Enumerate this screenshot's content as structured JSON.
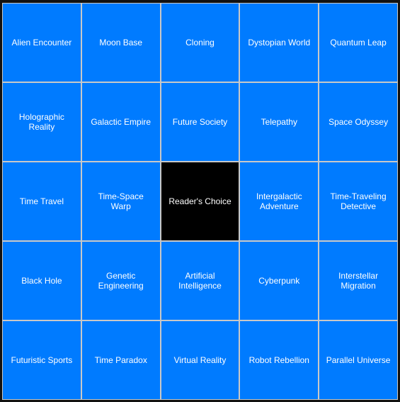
{
  "board": {
    "colors": {
      "cell": "#007bff",
      "free": "#000000",
      "text": "#ffffff",
      "grid": "#c8c8c8",
      "background": "#111111"
    },
    "cells": [
      "Alien Encounter",
      "Moon Base",
      "Cloning",
      "Dystopian World",
      "Quantum Leap",
      "Holographic Reality",
      "Galactic Empire",
      "Future Society",
      "Telepathy",
      "Space Odyssey",
      "Time Travel",
      "Time-Space Warp",
      "Reader's Choice",
      "Intergalactic Adventure",
      "Time-Traveling Detective",
      "Black Hole",
      "Genetic Engineering",
      "Artificial Intelligence",
      "Cyberpunk",
      "Interstellar Migration",
      "Futuristic Sports",
      "Time Paradox",
      "Virtual Reality",
      "Robot Rebellion",
      "Parallel Universe"
    ],
    "free_index": 12
  }
}
